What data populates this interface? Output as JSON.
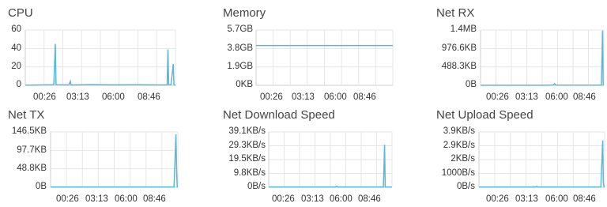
{
  "colors": {
    "line": "#5bb8d6",
    "grid": "#e6e6e6",
    "axis": "#cfcfcf",
    "text": "#444444"
  },
  "charts": [
    {
      "title": "CPU",
      "y_labels": [
        "60",
        "40",
        "20",
        "0"
      ],
      "x_labels": [
        "00:26",
        "03:13",
        "06:00",
        "08:46"
      ]
    },
    {
      "title": "Memory",
      "y_labels": [
        "5.7GB",
        "3.8GB",
        "1.9GB",
        "0KB"
      ],
      "x_labels": [
        "00:26",
        "03:13",
        "06:00",
        "08:46"
      ]
    },
    {
      "title": "Net RX",
      "y_labels": [
        "1.4MB",
        "976.6KB",
        "488.3KB",
        "0B"
      ],
      "x_labels": [
        "00:26",
        "03:13",
        "06:00",
        "08:46"
      ]
    },
    {
      "title": "Net TX",
      "y_labels": [
        "146.5KB",
        "97.7KB",
        "48.8KB",
        "0B"
      ],
      "x_labels": [
        "00:26",
        "03:13",
        "06:00",
        "08:46"
      ]
    },
    {
      "title": "Net Download Speed",
      "y_labels": [
        "39.1KB/s",
        "29.3KB/s",
        "19.5KB/s",
        "9.8KB/s",
        "0B/s"
      ],
      "x_labels": [
        "00:26",
        "03:13",
        "06:00",
        "08:46"
      ]
    },
    {
      "title": "Net Upload Speed",
      "y_labels": [
        "3.9KB/s",
        "2.9KB/s",
        "2KB/s",
        "1000B/s",
        "0B/s"
      ],
      "x_labels": [
        "00:26",
        "03:13",
        "06:00",
        "08:46"
      ]
    }
  ],
  "chart_data": [
    {
      "type": "line",
      "title": "CPU",
      "ylim": [
        0,
        60
      ],
      "x_ticks": [
        "00:26",
        "03:13",
        "06:00",
        "08:46"
      ],
      "series": [
        {
          "values": [
            [
              0,
              0.3
            ],
            [
              0.1,
              0.4
            ],
            [
              0.19,
              0.6
            ],
            [
              0.2,
              45
            ],
            [
              0.205,
              0.6
            ],
            [
              0.25,
              0.5
            ],
            [
              0.29,
              0.4
            ],
            [
              0.3,
              4.5
            ],
            [
              0.305,
              0.4
            ],
            [
              0.45,
              0.8
            ],
            [
              0.6,
              0.5
            ],
            [
              0.75,
              0.6
            ],
            [
              0.9,
              0.4
            ],
            [
              0.945,
              0.5
            ],
            [
              0.95,
              39
            ],
            [
              0.955,
              0.6
            ],
            [
              0.97,
              0.5
            ],
            [
              0.985,
              23
            ],
            [
              0.99,
              0.5
            ],
            [
              1.0,
              0.3
            ]
          ]
        }
      ]
    },
    {
      "type": "line",
      "title": "Memory",
      "ylim": [
        0,
        5.7
      ],
      "y_unit": "GB",
      "x_ticks": [
        "00:26",
        "03:13",
        "06:00",
        "08:46"
      ],
      "series": [
        {
          "values": [
            [
              0,
              4.1
            ],
            [
              1,
              4.1
            ]
          ]
        }
      ]
    },
    {
      "type": "line",
      "title": "Net RX",
      "ylim": [
        0,
        1464.9
      ],
      "y_unit": "KB",
      "x_ticks": [
        "00:26",
        "03:13",
        "06:00",
        "08:46"
      ],
      "series": [
        {
          "values": [
            [
              0,
              2
            ],
            [
              0.5,
              2
            ],
            [
              0.59,
              8
            ],
            [
              0.6,
              45
            ],
            [
              0.61,
              6
            ],
            [
              0.9,
              4
            ],
            [
              0.98,
              6
            ],
            [
              0.99,
              1450
            ],
            [
              0.995,
              6
            ],
            [
              1.0,
              4
            ]
          ]
        }
      ]
    },
    {
      "type": "line",
      "title": "Net TX",
      "ylim": [
        0,
        146.5
      ],
      "y_unit": "KB",
      "x_ticks": [
        "00:26",
        "03:13",
        "06:00",
        "08:46"
      ],
      "series": [
        {
          "values": [
            [
              0,
              0.5
            ],
            [
              0.97,
              0.6
            ],
            [
              0.985,
              140
            ],
            [
              0.99,
              50
            ],
            [
              0.995,
              1
            ],
            [
              1.0,
              0.5
            ]
          ]
        }
      ]
    },
    {
      "type": "line",
      "title": "Net Download Speed",
      "ylim": [
        0,
        39.1
      ],
      "y_unit": "KB/s",
      "x_ticks": [
        "00:26",
        "03:13",
        "06:00",
        "08:46"
      ],
      "series": [
        {
          "values": [
            [
              0,
              0.1
            ],
            [
              0.54,
              0.1
            ],
            [
              0.55,
              0.7
            ],
            [
              0.56,
              0.1
            ],
            [
              0.93,
              0.1
            ],
            [
              0.94,
              30
            ],
            [
              0.945,
              0.2
            ],
            [
              1.0,
              0.1
            ]
          ]
        }
      ]
    },
    {
      "type": "line",
      "title": "Net Upload Speed",
      "ylim": [
        0,
        3.9
      ],
      "y_unit": "KB/s",
      "x_ticks": [
        "00:26",
        "03:13",
        "06:00",
        "08:46"
      ],
      "series": [
        {
          "values": [
            [
              0,
              0.01
            ],
            [
              0.45,
              0.01
            ],
            [
              0.46,
              0.06
            ],
            [
              0.47,
              0.01
            ],
            [
              0.97,
              0.01
            ],
            [
              0.985,
              3.3
            ],
            [
              0.99,
              0.3
            ],
            [
              0.995,
              0.02
            ],
            [
              1.0,
              0.01
            ]
          ]
        }
      ]
    }
  ]
}
